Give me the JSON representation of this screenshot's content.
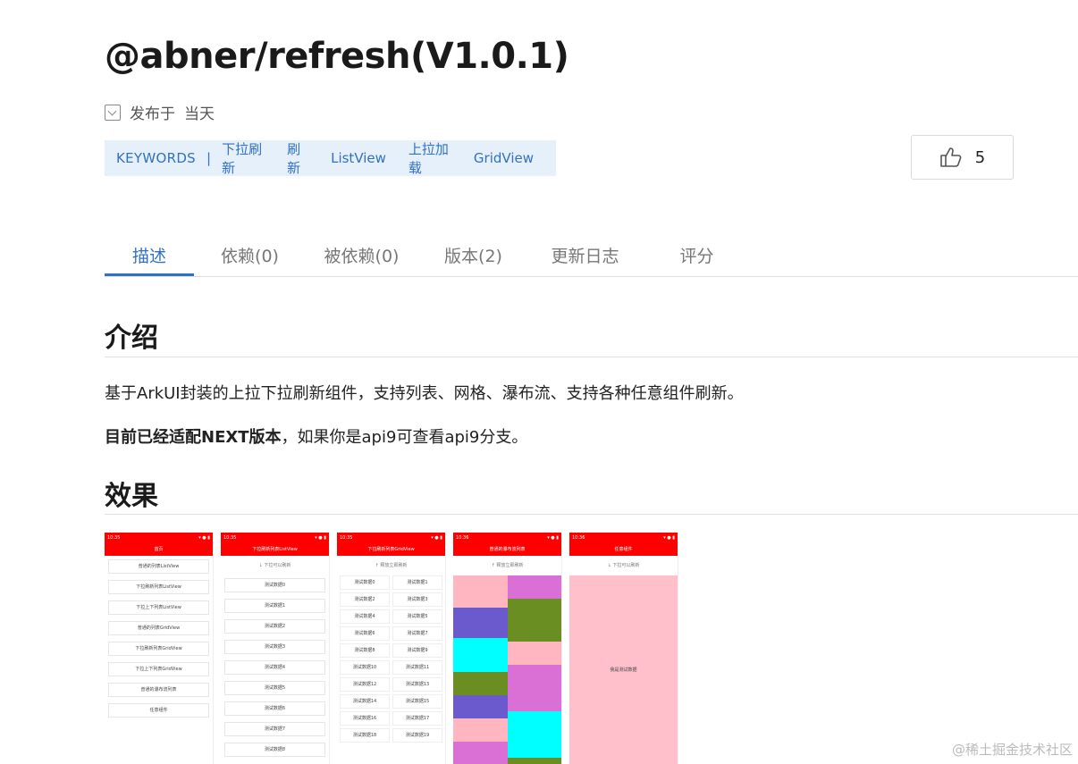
{
  "package": {
    "title": "@abner/refresh(V1.0.1)",
    "published_prefix": "发布于",
    "published_when": "当天"
  },
  "keywords": {
    "label": "KEYWORDS",
    "separator": "|",
    "items": [
      "下拉刷新",
      "刷新",
      "ListView",
      "上拉加载",
      "GridView"
    ]
  },
  "like": {
    "count": "5"
  },
  "tabs": [
    {
      "label": "描述",
      "active": true
    },
    {
      "label": "依赖(0)"
    },
    {
      "label": "被依赖(0)"
    },
    {
      "label": "版本(2)"
    },
    {
      "label": "更新日志"
    },
    {
      "label": "评分"
    }
  ],
  "content": {
    "intro_heading": "介绍",
    "intro_text": "基于ArkUI封装的上拉下拉刷新组件，支持列表、网格、瀑布流、支持各种任意组件刷新。",
    "next_bold": "目前已经适配NEXT版本",
    "next_rest": "，如果你是api9可查看api9分支。",
    "effect_heading": "效果"
  },
  "screens": {
    "p1": {
      "time": "10:35",
      "title": "首页",
      "rows": [
        "普通的列表ListView",
        "下拉刷新列表ListView",
        "下拉上下列表ListView",
        "普通的列表GridView",
        "下拉刷新列表GridView",
        "下拉上下列表GridView",
        "普通的瀑布流列表",
        "任意组件"
      ]
    },
    "p2": {
      "time": "10:35",
      "title": "下拉刷新列表ListView",
      "pull": "下拉可以刷新",
      "rows": [
        "测试数据0",
        "测试数据1",
        "测试数据2",
        "测试数据3",
        "测试数据4",
        "测试数据5",
        "测试数据6",
        "测试数据7",
        "测试数据8"
      ]
    },
    "p3": {
      "time": "10:35",
      "title": "下拉刷新列表GridView",
      "pull": "释放立即刷新",
      "cells": [
        "测试数据0",
        "测试数据1",
        "测试数据2",
        "测试数据3",
        "测试数据4",
        "测试数据5",
        "测试数据6",
        "测试数据7",
        "测试数据8",
        "测试数据9",
        "测试数据10",
        "测试数据11",
        "测试数据12",
        "测试数据13",
        "测试数据14",
        "测试数据15",
        "测试数据16",
        "测试数据17",
        "测试数据18",
        "测试数据19"
      ]
    },
    "p4": {
      "time": "10:36",
      "title": "普通的瀑布流列表",
      "pull": "释放立即刷新"
    },
    "p5": {
      "time": "10:36",
      "title": "任意组件",
      "pull": "下拉可以刷新",
      "center": "我是测试数据"
    }
  },
  "watermark": {
    "footer": "@稀土掘金技术社区"
  },
  "colors": {
    "accent": "#3271c2",
    "phone_bar": "#ff0000"
  }
}
